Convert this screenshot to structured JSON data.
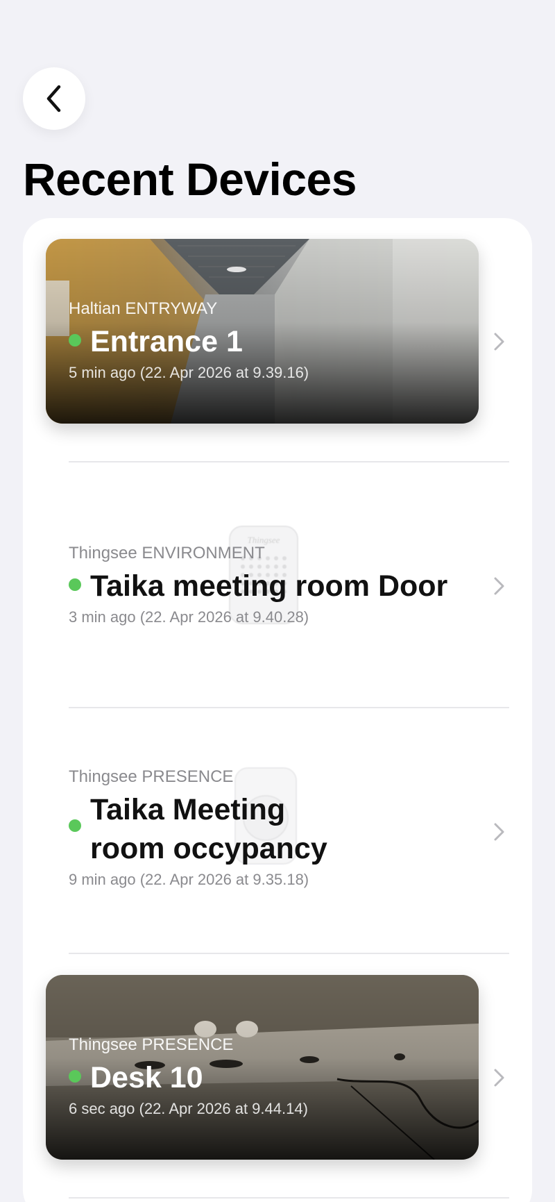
{
  "header": {
    "back_icon": "chevron-left-icon",
    "title": "Recent Devices"
  },
  "devices": [
    {
      "category": "Haltian ENTRYWAY",
      "name": "Entrance 1",
      "time": "5 min ago (22. Apr 2026 at 9.39.16)",
      "status": "online",
      "image": "corridor-photo"
    },
    {
      "category": "Thingsee ENVIRONMENT",
      "name": "Taika meeting room Door",
      "time": "3 min ago (22. Apr 2026 at 9.40.28)",
      "status": "online",
      "image": "environment-sensor-illustration",
      "device_label": "Thingsee"
    },
    {
      "category": "Thingsee PRESENCE",
      "name": "Taika Meeting room occypancy",
      "time": "9 min ago (22. Apr 2026 at 9.35.18)",
      "status": "online",
      "image": "presence-sensor-illustration"
    },
    {
      "category": "Thingsee PRESENCE",
      "name": "Desk 10",
      "time": "6 sec ago (22. Apr 2026 at 9.44.14)",
      "status": "online",
      "image": "desk-underside-photo"
    }
  ],
  "colors": {
    "background": "#f2f2f7",
    "card": "#ffffff",
    "status_online": "#5ac85a",
    "secondary_text": "#8a8a8e"
  }
}
